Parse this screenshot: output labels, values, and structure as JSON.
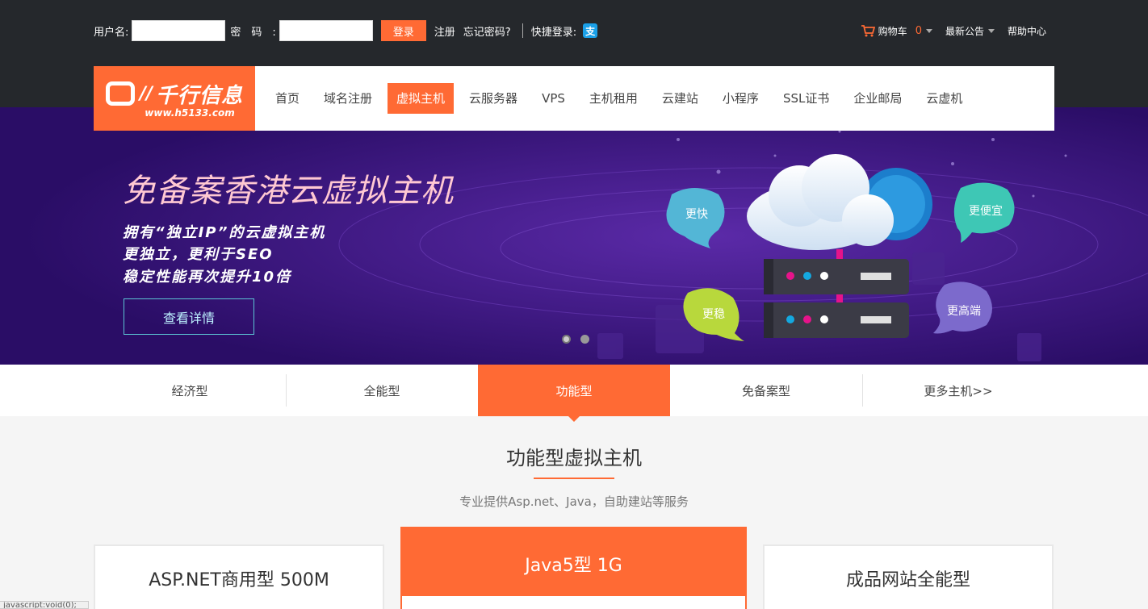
{
  "topbar": {
    "username_label": "用户名:",
    "username_value": "",
    "password_label": "密码:",
    "password_value": "",
    "login_button": "登录",
    "register_link": "注册",
    "forgot_link": "忘记密码?",
    "quick_login_label": "快捷登录:",
    "alipay_glyph": "支",
    "cart_label": "购物车",
    "cart_count": "0",
    "notice_label": "最新公告",
    "help_label": "帮助中心"
  },
  "nav": {
    "logo_name": "千行信息",
    "logo_url": "www.h5133.com",
    "logo_slashes": "//",
    "items": [
      {
        "label": "首页",
        "active": false
      },
      {
        "label": "域名注册",
        "active": false
      },
      {
        "label": "虚拟主机",
        "active": true
      },
      {
        "label": "云服务器",
        "active": false
      },
      {
        "label": "VPS",
        "active": false
      },
      {
        "label": "主机租用",
        "active": false
      },
      {
        "label": "云建站",
        "active": false
      },
      {
        "label": "小程序",
        "active": false
      },
      {
        "label": "SSL证书",
        "active": false
      },
      {
        "label": "企业邮局",
        "active": false
      },
      {
        "label": "云虚机",
        "active": false
      }
    ]
  },
  "banner": {
    "title": "免备案香港云虚拟主机",
    "lines": [
      "拥有“独立IP”的云虚拟主机",
      "更独立，更利于SEO",
      "稳定性能再次提升10倍"
    ],
    "button": "查看详情",
    "bubbles": [
      "更快",
      "更便宜",
      "更稳",
      "更高端"
    ],
    "slide_count": 2,
    "active_slide": 1
  },
  "tabs": [
    {
      "label": "经济型",
      "active": false
    },
    {
      "label": "全能型",
      "active": false
    },
    {
      "label": "功能型",
      "active": true
    },
    {
      "label": "免备案型",
      "active": false
    },
    {
      "label": "更多主机>>",
      "active": false
    }
  ],
  "section": {
    "title": "功能型虚拟主机",
    "subtitle": "专业提供Asp.net、Java，自助建站等服务"
  },
  "cards": [
    {
      "title": "ASP.NET商用型 500M"
    },
    {
      "title": "Java5型 1G"
    },
    {
      "title": "成品网站全能型"
    }
  ],
  "status_text": "javascript:void(0);",
  "colors": {
    "accent": "#ff6a34",
    "topbar": "#25282c",
    "banner": "#2a0d66"
  }
}
